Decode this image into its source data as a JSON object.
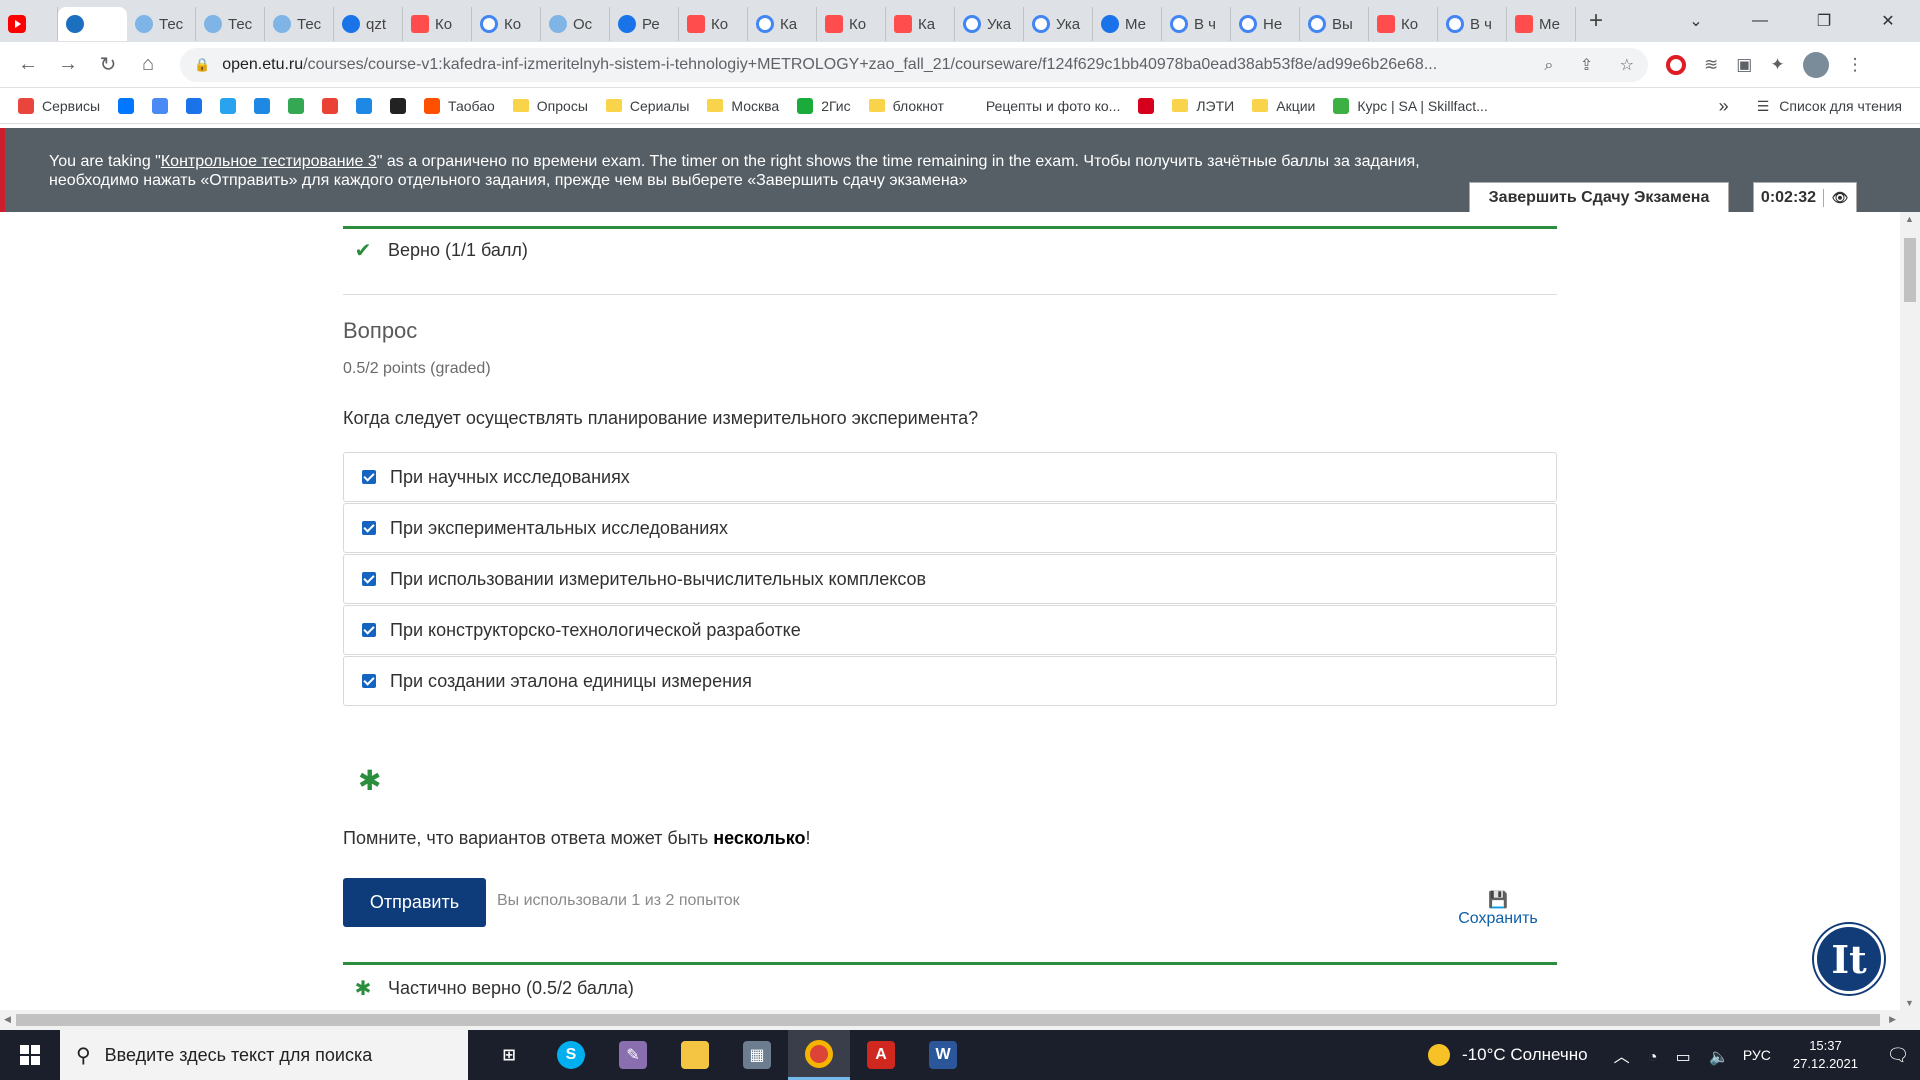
{
  "browser": {
    "tabs": [
      {
        "label": "",
        "icon": "youtube-icon",
        "fav": "fav-yt",
        "first": true
      },
      {
        "label": "",
        "icon": "edu-site-icon",
        "fav": "fav-e",
        "active": true
      },
      {
        "label": "Тес",
        "icon": "loading-icon",
        "fav": "fav-o"
      },
      {
        "label": "Тес",
        "icon": "loading-icon",
        "fav": "fav-o"
      },
      {
        "label": "Тес",
        "icon": "loading-icon",
        "fav": "fav-o"
      },
      {
        "label": "qzt",
        "icon": "s-icon",
        "fav": "fav-s"
      },
      {
        "label": "Ко",
        "icon": "m-icon",
        "fav": "fav-m"
      },
      {
        "label": "Ко",
        "icon": "google-icon",
        "fav": "fav-g"
      },
      {
        "label": "Ос",
        "icon": "glasses-icon",
        "fav": "fav-o"
      },
      {
        "label": "Ре",
        "icon": "s-icon",
        "fav": "fav-s"
      },
      {
        "label": "Ко",
        "icon": "m-icon",
        "fav": "fav-m"
      },
      {
        "label": "Ка",
        "icon": "google-icon",
        "fav": "fav-g"
      },
      {
        "label": "Ко",
        "icon": "m-icon",
        "fav": "fav-m"
      },
      {
        "label": "Ка",
        "icon": "flag-icon",
        "fav": "fav-m"
      },
      {
        "label": "Ука",
        "icon": "google-icon",
        "fav": "fav-g"
      },
      {
        "label": "Ука",
        "icon": "google-icon",
        "fav": "fav-g"
      },
      {
        "label": "Ме",
        "icon": "s-icon",
        "fav": "fav-s"
      },
      {
        "label": "В ч",
        "icon": "google-icon",
        "fav": "fav-g"
      },
      {
        "label": "Не",
        "icon": "google-icon",
        "fav": "fav-g"
      },
      {
        "label": "Вы",
        "icon": "google-icon",
        "fav": "fav-g"
      },
      {
        "label": "Ко",
        "icon": "m-icon",
        "fav": "fav-m"
      },
      {
        "label": "В ч",
        "icon": "google-icon",
        "fav": "fav-g"
      },
      {
        "label": "Ме",
        "icon": "m-icon",
        "fav": "fav-m"
      }
    ],
    "url_host": "open.etu.ru",
    "url_path": "/courses/course-v1:kafedra-inf-izmeritelnyh-sistem-i-tehnologiy+METROLOGY+zao_fall_21/courseware/f124f629c1bb40978ba0ead38ab53f8e/ad99e6b26e68...",
    "bookmarks": [
      {
        "label": "Сервисы",
        "color": "#e8453c"
      },
      {
        "label": "",
        "color": "#0077ff"
      },
      {
        "label": "",
        "color": "#4a8af4"
      },
      {
        "label": "",
        "color": "#1a73e8"
      },
      {
        "label": "",
        "color": "#2aa3ef"
      },
      {
        "label": "",
        "color": "#1e88e5"
      },
      {
        "label": "",
        "color": "#34a853"
      },
      {
        "label": "",
        "color": "#ea4335"
      },
      {
        "label": "",
        "color": "#1e88e5"
      },
      {
        "label": "",
        "color": "#222222"
      },
      {
        "label": "Таобао",
        "color": "#ff5000"
      },
      {
        "label": "Опросы",
        "folder": true
      },
      {
        "label": "Сериалы",
        "folder": true
      },
      {
        "label": "Москва",
        "folder": true
      },
      {
        "label": "2Гис",
        "color": "#1bab3a"
      },
      {
        "label": "блокнот",
        "folder": true
      },
      {
        "label": "Рецепты и фото ко...",
        "color": "#ffffff"
      },
      {
        "label": "",
        "color": "#d6001c"
      },
      {
        "label": "ЛЭТИ",
        "folder": true
      },
      {
        "label": "Акции",
        "folder": true
      },
      {
        "label": "Курс | SA | Skillfact...",
        "color": "#3cb043"
      }
    ],
    "bookmarks_more": "»",
    "reading_list": "Список для чтения"
  },
  "banner": {
    "pre": "You are taking \"",
    "exam_link": "Контрольное тестирование 3",
    "post": "\" as a ограничено по времени exam. The timer on the right shows the time remaining in the exam. Чтобы получить зачётные баллы за задания, необходимо нажать «Отправить» для каждого отдельного задания, прежде чем вы выберете «Завершить сдачу экзамена»",
    "finish_label": "Завершить Сдачу Экзамена",
    "timer": "0:02:32"
  },
  "prev_result": "Верно (1/1 балл)",
  "question": {
    "title": "Вопрос",
    "points": "0.5/2 points (graded)",
    "text": "Когда следует осуществлять планирование измерительного эксперимента?",
    "options": [
      {
        "label": "При научных исследованиях",
        "checked": true
      },
      {
        "label": "При экспериментальных исследованиях",
        "checked": true
      },
      {
        "label": "При использовании измерительно-вычислительных комплексов",
        "checked": true
      },
      {
        "label": "При конструкторско-технологической разработке",
        "checked": true
      },
      {
        "label": "При создании эталона единицы измерения",
        "checked": true
      }
    ],
    "reminder_pre": "Помните, что вариантов ответа может быть ",
    "reminder_bold": "несколько",
    "reminder_post": "!",
    "submit_label": "Отправить",
    "attempts": "Вы использовали 1 из 2 попыток",
    "save_label": "Сохранить",
    "result": "Частично верно (0.5/2 балла)"
  },
  "taskbar": {
    "search_placeholder": "Введите здесь текст для поиска",
    "weather": "-10°C  Солнечно",
    "lang": "РУС",
    "time": "15:37",
    "date": "27.12.2021"
  }
}
